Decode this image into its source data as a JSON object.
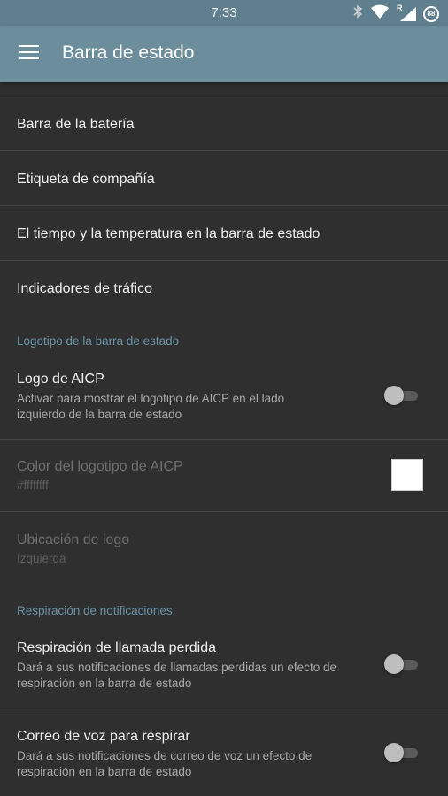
{
  "status_bar": {
    "time": "7:33",
    "icons": [
      "bluetooth-icon",
      "wifi-icon",
      "signal-roaming-icon",
      "battery-icon"
    ],
    "battery_level": "88",
    "roaming_indicator": "R"
  },
  "app_bar": {
    "title": "Barra de estado",
    "menu_icon": "hamburger-menu-icon"
  },
  "items": {
    "battery_bar": {
      "title": "Barra de la batería"
    },
    "carrier_label": {
      "title": "Etiqueta de compañía"
    },
    "weather": {
      "title": "El tiempo y la temperatura en la barra de estado"
    },
    "traffic": {
      "title": "Indicadores de tráfico"
    },
    "logo_section": {
      "title": "Logotipo de la barra de estado"
    },
    "aicp_logo": {
      "title": "Logo de AICP",
      "summary": "Activar para mostrar el logotipo de AICP en el lado izquierdo de la barra de estado",
      "enabled": false
    },
    "logo_color": {
      "title": "Color del logotipo de AICP",
      "summary": "#ffffffff",
      "color": "#ffffff"
    },
    "logo_location": {
      "title": "Ubicación de logo",
      "summary": "Izquierda"
    },
    "breathing_section": {
      "title": "Respiración de notificaciones"
    },
    "missed_call": {
      "title": "Respiración de llamada perdida",
      "summary": "Dará a sus notificaciones de llamadas perdidas un efecto de respiración en la barra de estado",
      "enabled": false
    },
    "voicemail": {
      "title": "Correo de voz para respirar",
      "summary": "Dará a sus notificaciones de correo de voz un efecto de respiración en la barra de estado",
      "enabled": false
    }
  }
}
